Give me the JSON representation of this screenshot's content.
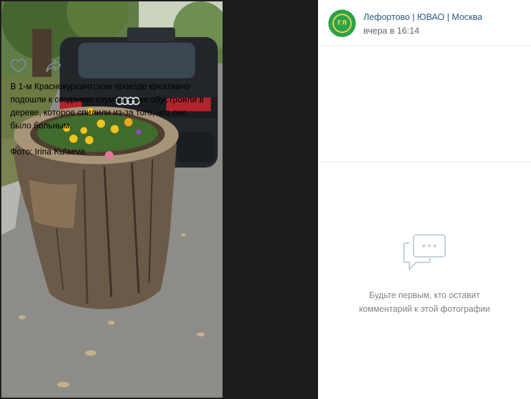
{
  "post": {
    "author": "Лефортово | ЮВАО | Москва",
    "date": "вчера в 16:14",
    "avatar_text": "ГЛ",
    "text_main": "В 1-м Краснокурсантском проезде креативно подошли к созданию клумбы — ее обустроили в дереве, которое спилили из-за того, что оно было больным.",
    "text_credit": "Фото: Irina Kulaeva."
  },
  "actions": {
    "like_icon": "heart-icon",
    "share_icon": "share-arrow-icon"
  },
  "comments": {
    "empty_line1": "Будьте первым, кто оставит",
    "empty_line2": "комментарий к этой фотографии",
    "icon": "comment-bubble-icon"
  },
  "colors": {
    "link": "#2a5885",
    "muted": "#828282",
    "avatar_bg": "#2aa34a",
    "avatar_ring": "#f3d34a"
  }
}
